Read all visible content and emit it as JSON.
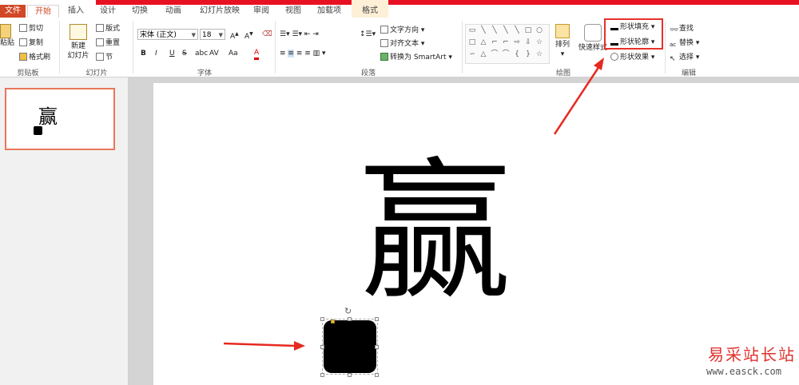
{
  "tabs": [
    "文件",
    "开始",
    "插入",
    "设计",
    "切换",
    "动画",
    "幻灯片放映",
    "审阅",
    "视图",
    "加载项",
    "格式"
  ],
  "groups": {
    "clipboard": "剪贴板",
    "slides": "幻灯片",
    "font": "字体",
    "paragraph": "段落",
    "drawing": "绘图",
    "editing": "编辑"
  },
  "clipboard": {
    "paste": "粘贴",
    "cut": "剪切",
    "copy": "复制",
    "painter": "格式刷"
  },
  "slides": {
    "new_slide_1": "新建",
    "new_slide_2": "幻灯片",
    "layout": "版式",
    "reset": "重置",
    "section": "节"
  },
  "font": {
    "name": "宋体 (正文)",
    "size": "18",
    "bold": "B",
    "italic": "I",
    "underline": "U",
    "shadow": "S",
    "spacing": "AV",
    "case": "Aa",
    "color": "A"
  },
  "paragraph": {
    "direction": "文字方向",
    "align": "对齐文本",
    "smartart": "转换为 SmartArt"
  },
  "drawing": {
    "arrange": "排列",
    "quick_styles": "快速样式",
    "shape_fill": "形状填充",
    "shape_outline": "形状轮廓",
    "shape_effects": "形状效果"
  },
  "editing": {
    "find": "查找",
    "replace": "替换",
    "select": "选择"
  },
  "slide_thumb": {
    "char": "赢"
  },
  "slide": {
    "char": "赢"
  },
  "watermark": {
    "title": "易采站长站",
    "url": "www.easck.com"
  }
}
